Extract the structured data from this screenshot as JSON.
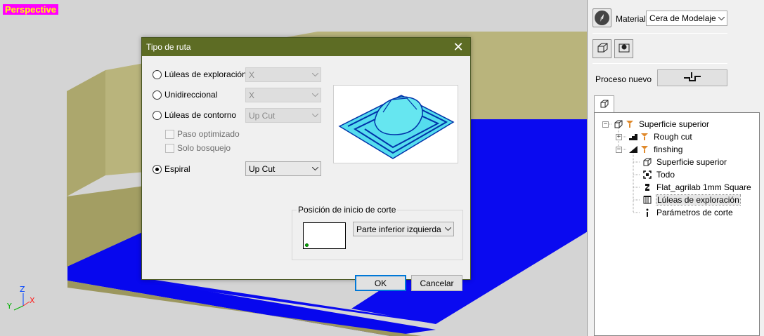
{
  "viewport": {
    "view_label": "Perspective",
    "axes": {
      "z": "Z",
      "y": "Y",
      "x": "X"
    }
  },
  "dialog": {
    "title": "Tipo de ruta",
    "options": [
      {
        "label": "Lúleas de exploración",
        "dropdown": "X",
        "selected": false
      },
      {
        "label": "Unidireccional",
        "dropdown": "X",
        "selected": false
      },
      {
        "label": "Lúleas de contorno",
        "dropdown": "Up Cut",
        "selected": false
      },
      {
        "label": "Espiral",
        "dropdown": "Up Cut",
        "selected": true
      }
    ],
    "checkboxes": [
      {
        "label": "Paso optimizado",
        "checked": false
      },
      {
        "label": "Solo bosquejo",
        "checked": false
      }
    ],
    "start_group": {
      "label": "Posición de inicio de corte",
      "dropdown": "Parte inferior izquierda"
    },
    "ok_label": "OK",
    "cancel_label": "Cancelar"
  },
  "panel": {
    "material_label": "Material",
    "material_value": "Cera de Modelaje",
    "new_process_label": "Proceso nuevo",
    "tree": [
      {
        "label": "Superficie superior",
        "icon": "surface-icon"
      },
      {
        "label": "Rough cut",
        "icon": "rough-cut-icon"
      },
      {
        "label": "finshing",
        "icon": "finishing-icon"
      },
      {
        "label": "Superficie superior",
        "icon": "surface-icon"
      },
      {
        "label": "Todo",
        "icon": "select-all-icon"
      },
      {
        "label": "Flat_agrilab 1mm Square",
        "icon": "tool-icon"
      },
      {
        "label": "Lúleas de exploración",
        "icon": "scan-lines-icon"
      },
      {
        "label": "Parámetros de corte",
        "icon": "info-icon"
      }
    ]
  },
  "colors": {
    "dialog_title_bg": "#5d6c24",
    "stock": "#b8b27a",
    "toolpath": "#0000ff",
    "label_bg": "#ff00ff",
    "label_fg": "#ffff00"
  }
}
